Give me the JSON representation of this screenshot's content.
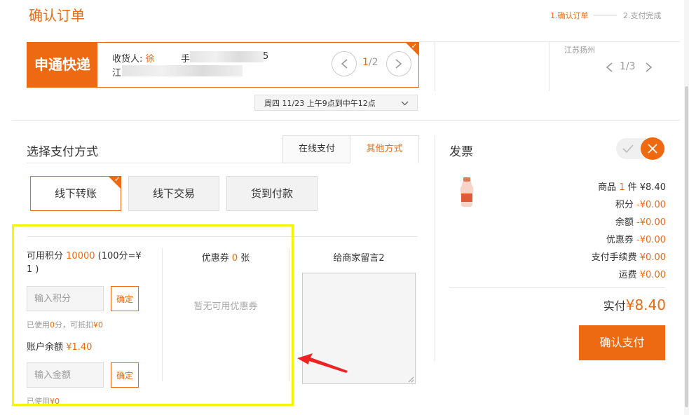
{
  "page": {
    "title": "确认订单"
  },
  "steps": {
    "step1": "1.确认订单",
    "step2": "2.支付完成"
  },
  "address": {
    "courier": "申通快递",
    "receiver_label": "收货人:",
    "receiver_name": "徐",
    "phone_label": "手",
    "phone_tail": "5",
    "addr_prefix": "江",
    "page_current": "1",
    "page_total": "/2"
  },
  "side_address": {
    "region": "江苏扬州",
    "page_current": "1",
    "page_total": "/3"
  },
  "delivery_time": {
    "value": "周四 11/23 上午9点到中午12点"
  },
  "payment": {
    "heading": "选择支付方式",
    "tabs": [
      {
        "label": "在线支付"
      },
      {
        "label": "其他方式"
      }
    ],
    "methods": [
      {
        "label": "线下转账"
      },
      {
        "label": "线下交易"
      },
      {
        "label": "货到付款"
      }
    ]
  },
  "points": {
    "label_pre": "可用积分",
    "amount": "10000",
    "label_post": "(100分=¥",
    "label_post2": "1 )",
    "input_placeholder": "输入积分",
    "confirm_label": "确定",
    "used_pre": "已使用",
    "used_value": "0",
    "used_post": "分，可抵扣",
    "deduct_value": "¥0"
  },
  "balance": {
    "label": "账户余额",
    "amount": "¥1.40",
    "input_placeholder": "输入金额",
    "confirm_label": "确定",
    "used_pre": "已使用",
    "used_value": "¥0"
  },
  "coupon": {
    "label": "优惠券",
    "count": "0",
    "unit": "张",
    "empty": "暂无可用优惠券"
  },
  "message": {
    "label": "给商家留言2"
  },
  "invoice": {
    "label": "发票"
  },
  "summary": {
    "items_pre": "商品",
    "items_count": "1",
    "items_post": "件 ¥8.40",
    "points_label": "积分",
    "points_value": "-¥0.00",
    "balance_label": "余额",
    "balance_value": "-¥0.00",
    "coupon_label": "优惠券",
    "coupon_value": "-¥0.00",
    "fee_label": "支付手续费",
    "fee_value": "¥0.00",
    "shipping_label": "运费",
    "shipping_value": "¥0.00",
    "total_label": "实付",
    "total_value": "¥8.40",
    "confirm_button": "确认支付"
  },
  "colors": {
    "accent": "#ee6a12",
    "highlight": "#f5f50a",
    "arrow": "#ee2222"
  }
}
